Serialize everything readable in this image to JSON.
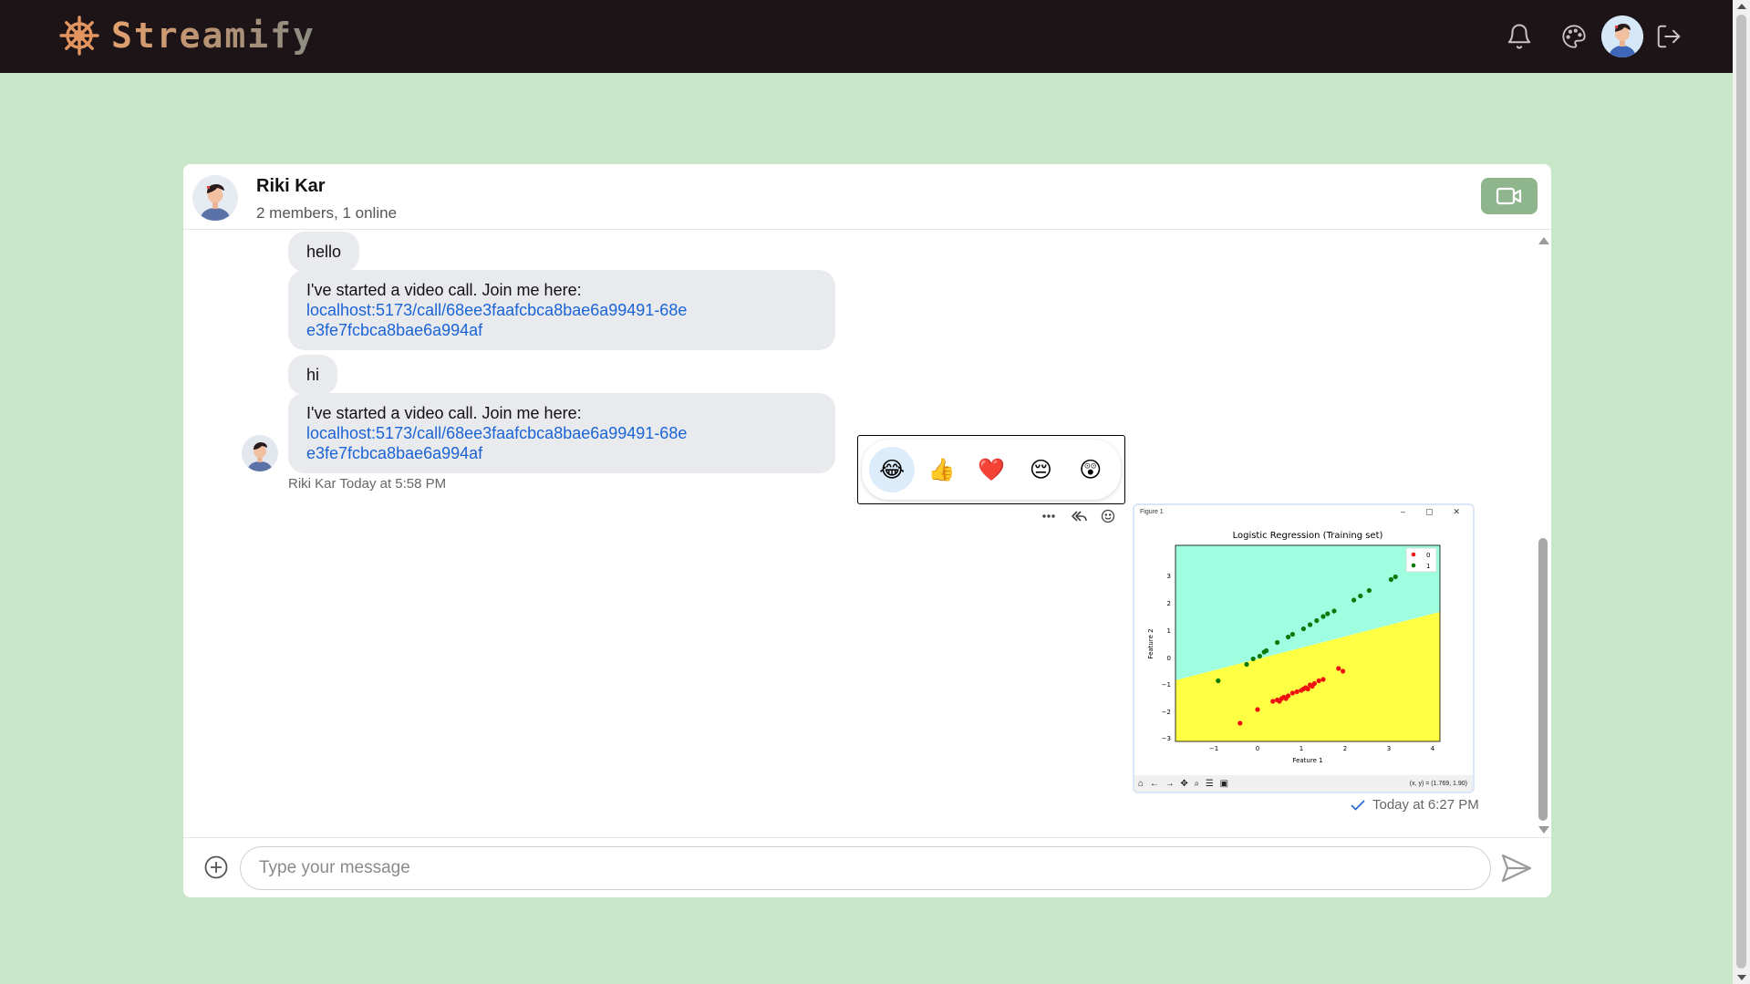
{
  "app": {
    "name": "Streamify"
  },
  "header": {
    "name": "Riki Kar",
    "subtitle": "2 members, 1 online"
  },
  "messages": [
    {
      "text": "hello"
    },
    {
      "intro": "I've started a video call. Join me here:",
      "link": "localhost:5173/call/68ee3faafcbca8bae6a99491-68ee3fe7fcbca8bae6a994af"
    },
    {
      "text": "hi"
    },
    {
      "intro": "I've started a video call. Join me here:",
      "link": "localhost:5173/call/68ee3faafcbca8bae6a99491-68ee3fe7fcbca8bae6a994af"
    }
  ],
  "message_meta": {
    "author": "Riki Kar",
    "time": "Today at 5:58 PM"
  },
  "reactions": [
    "😂",
    "👍",
    "❤️",
    "😔",
    "😲"
  ],
  "image_message": {
    "window_title": "Figure 1",
    "plot_title": "Logistic Regression (Training set)",
    "xlabel": "Feature 1",
    "ylabel": "Feature 2",
    "legend": [
      "0",
      "1"
    ],
    "coords_readout": "(x, y) = (1.769, 1.90)",
    "time": "Today at 6:27 PM"
  },
  "composer": {
    "placeholder": "Type your message"
  },
  "colors": {
    "navbar": "#1d1418",
    "page_bg": "#c8e6c8",
    "video_button": "#8fb58c",
    "link": "#1a64d6"
  }
}
